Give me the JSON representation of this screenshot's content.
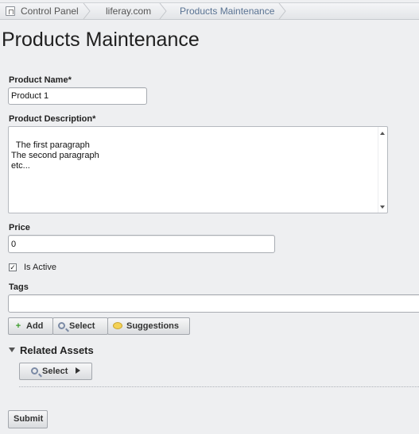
{
  "breadcrumb": {
    "items": [
      {
        "label": "Control Panel",
        "icon": "control-panel-icon"
      },
      {
        "label": "liferay.com"
      },
      {
        "label": "Products Maintenance"
      }
    ]
  },
  "page": {
    "title": "Products Maintenance"
  },
  "form": {
    "product_name": {
      "label": "Product Name*",
      "value": "Product 1"
    },
    "product_description": {
      "label": "Product Description*",
      "value": "The first paragraph\nThe second paragraph\netc..."
    },
    "price": {
      "label": "Price",
      "value": "0"
    },
    "is_active": {
      "label": "Is Active",
      "checked": true
    },
    "tags": {
      "label": "Tags",
      "value": ""
    },
    "tag_buttons": {
      "add": "Add",
      "select": "Select",
      "suggestions": "Suggestions"
    }
  },
  "related_assets": {
    "title": "Related Assets",
    "select_button": "Select"
  },
  "submit_label": "Submit",
  "colors": {
    "background": "#eeeff1",
    "breadcrumb_active": "#5a7393",
    "add_icon": "#3b9c2b"
  }
}
